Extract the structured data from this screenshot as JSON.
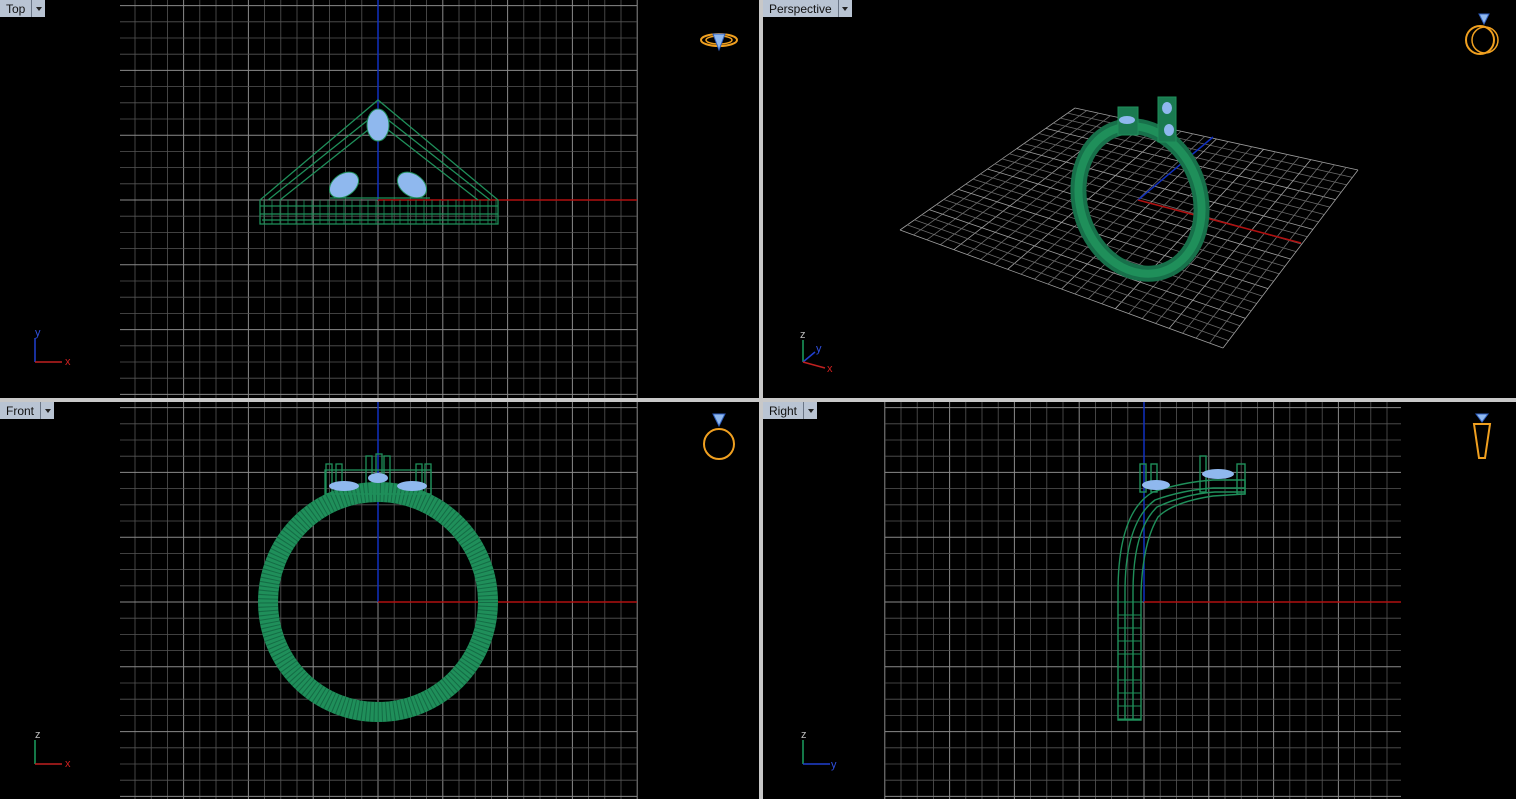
{
  "viewports": {
    "top": {
      "title": "Top",
      "axis_h": "x",
      "axis_v": "y"
    },
    "persp": {
      "title": "Perspective",
      "axis_h": "x",
      "axis_v": "y",
      "axis_z": "z"
    },
    "front": {
      "title": "Front",
      "axis_h": "x",
      "axis_v": "z"
    },
    "right": {
      "title": "Right",
      "axis_h": "y",
      "axis_v": "z"
    }
  },
  "colors": {
    "background": "#000000",
    "grid": "#5a5a5a",
    "grid_major": "#8a8a8a",
    "x_axis": "#b01010",
    "y_axis": "#1030c0",
    "model_wire": "#1f8f5a",
    "gem": "#8fb8ee",
    "view_icon": "#f0a020",
    "viewport_tab": "#b9c4d3"
  }
}
